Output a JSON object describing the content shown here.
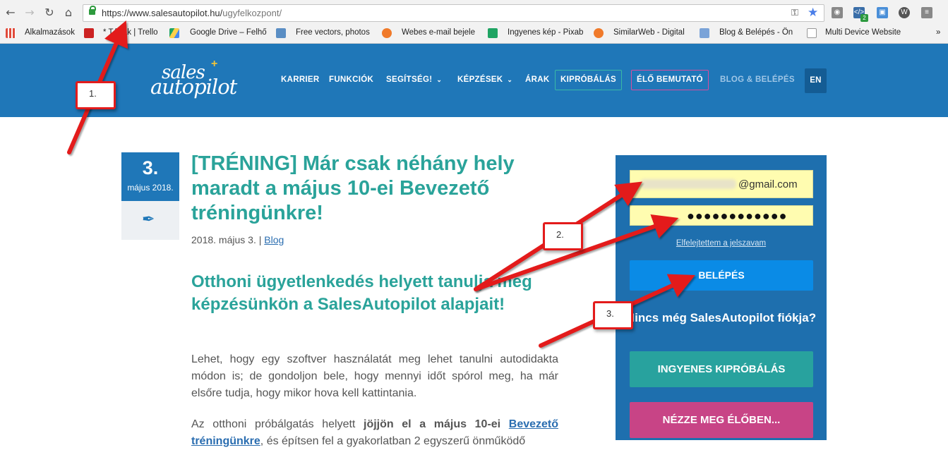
{
  "browser": {
    "url_base": "https://www.salesautopilot.hu/",
    "url_path": "ugyfelkozpont/",
    "ext_badge": "2",
    "bookmarks": [
      "Alkalmazások",
      "* Tár ák | Trello",
      "Google Drive – Felhő",
      "Free vectors, photos",
      "Webes e-mail bejele",
      "Ingyenes kép - Pixab",
      "SimilarWeb - Digital",
      "Blog & Belépés - Ön",
      "Multi Device Website"
    ]
  },
  "header": {
    "logo_line1": "sales",
    "logo_line2": "autopilot",
    "nav": [
      "KARRIER",
      "FUNKCIÓK",
      "SEGÍTSÉG!",
      "KÉPZÉSEK",
      "ÁRAK",
      "KIPRÓBÁLÁS",
      "ÉLŐ BEMUTATÓ",
      "BLOG & BELÉPÉS",
      "EN"
    ],
    "colors": {
      "bar": "#1f77b8",
      "trial_border": "#39b9a6",
      "live_border": "#d74d9f"
    }
  },
  "post": {
    "day": "3.",
    "month": "május 2018.",
    "title": "[TRÉNING] Már csak néhány hely maradt a május 10-ei Bevezető tréningünkre!",
    "meta_date": "2018. május 3.",
    "meta_sep": "|",
    "meta_cat": "Blog",
    "subtitle": "Otthoni ügyetlenkedés helyett tanulja meg képzésünkön a SalesAutopilot alapjait!",
    "p1": "Lehet, hogy egy szoftver használatát meg lehet tanulni autodidakta módon is; de gondoljon bele, hogy mennyi időt spórol meg, ha már elsőre tudja, hogy mikor hova kell kattintania.",
    "p2_a": "Az otthoni próbálgatás helyett ",
    "p2_b": "jöjjön el a május 10-ei ",
    "p2_link": "Bevezető tréningünkre",
    "p2_c": ", és építsen fel a gyakorlatban 2 egyszerű önműködő"
  },
  "login": {
    "email_domain": "@gmail.com",
    "password_mask": "●●●●●●●●●●●●",
    "forgot": "Elfelejtettem a jelszavam",
    "submit": "BELÉPÉS",
    "no_account": "Nincs még SalesAutopilot fiókja?",
    "trial": "INGYENES KIPRÓBÁLÁS",
    "demo": "NÉZZE MEG ÉLŐBEN..."
  },
  "annotations": {
    "callout1": "1.",
    "callout2": "2.",
    "callout3": "3.",
    "arrow_color": "#e31b1b"
  }
}
